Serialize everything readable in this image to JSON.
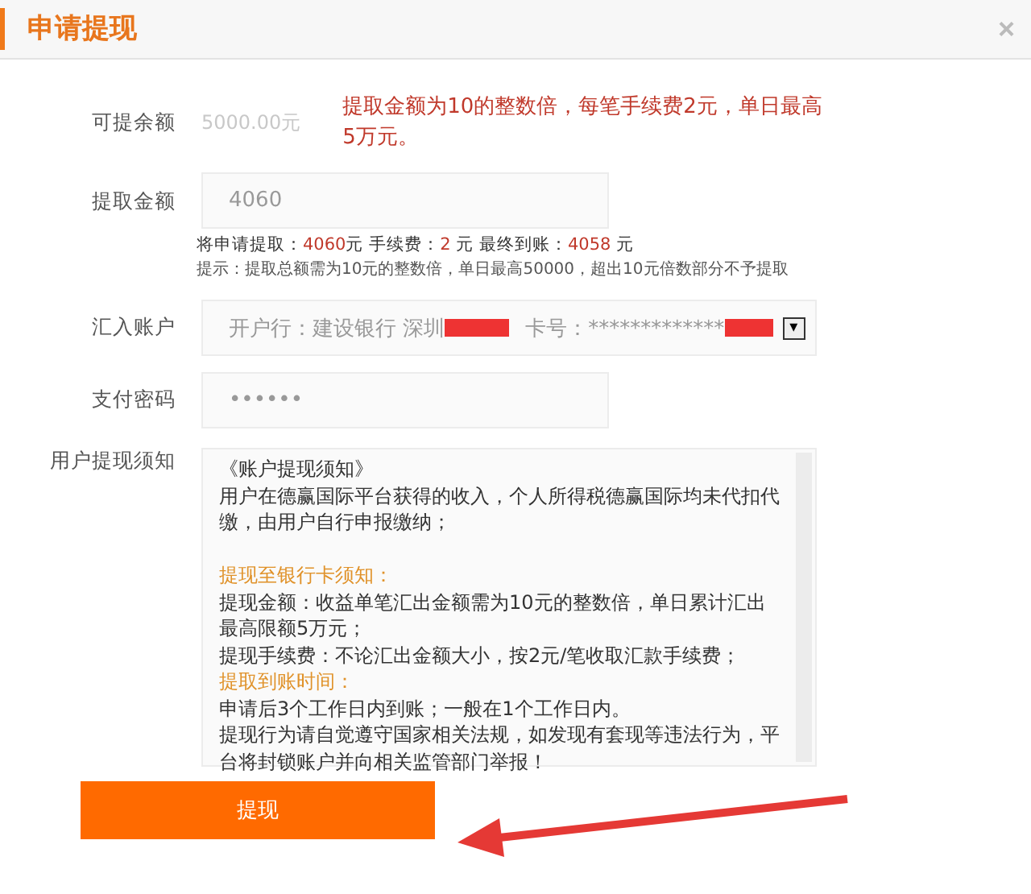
{
  "dialog": {
    "title": "申请提现",
    "close": "×"
  },
  "annotation": {
    "text": "提取金额为10的整数倍，每笔手续费2元，单日最高5万元。"
  },
  "balance": {
    "label": "可提余额",
    "value": "5000.00元"
  },
  "amount": {
    "label": "提取金额",
    "value": "4060",
    "summary": [
      {
        "text": "将申请提取：",
        "highlight": false
      },
      {
        "text": "4060",
        "highlight": true
      },
      {
        "text": "元 手续费：",
        "highlight": false
      },
      {
        "text": "2",
        "highlight": true
      },
      {
        "text": " 元 最终到账：",
        "highlight": false
      },
      {
        "text": "4058",
        "highlight": true
      },
      {
        "text": " 元",
        "highlight": false
      }
    ],
    "hint": "提示：提取总额需为10元的整数倍，单日最高50000，超出10元倍数部分不予提取"
  },
  "account": {
    "label": "汇入账户",
    "bank": "开户行：建设银行 深圳",
    "card": "卡号：*************",
    "dropdown": "▾"
  },
  "password": {
    "label": "支付密码",
    "value": "••••••"
  },
  "notice": {
    "label": "用户提现须知",
    "lines": [
      {
        "kind": "text",
        "text": "《账户提现须知》"
      },
      {
        "kind": "text",
        "text": "用户在德赢国际平台获得的收入，个人所得税德赢国际均未代扣代缴，由用户自行申报缴纳；"
      },
      {
        "kind": "blank"
      },
      {
        "kind": "heading",
        "text": "提现至银行卡须知："
      },
      {
        "kind": "text",
        "text": "提现金额：收益单笔汇出金额需为10元的整数倍，单日累计汇出最高限额5万元；"
      },
      {
        "kind": "text",
        "text": "提现手续费：不论汇出金额大小，按2元/笔收取汇款手续费；"
      },
      {
        "kind": "heading",
        "text": "提取到账时间："
      },
      {
        "kind": "text",
        "text": "申请后3个工作日内到账；一般在1个工作日内。"
      },
      {
        "kind": "text",
        "text": "提现行为请自觉遵守国家相关法规，如发现有套现等违法行为，平台将封锁账户并向相关监管部门举报！"
      }
    ]
  },
  "submit": "提现"
}
